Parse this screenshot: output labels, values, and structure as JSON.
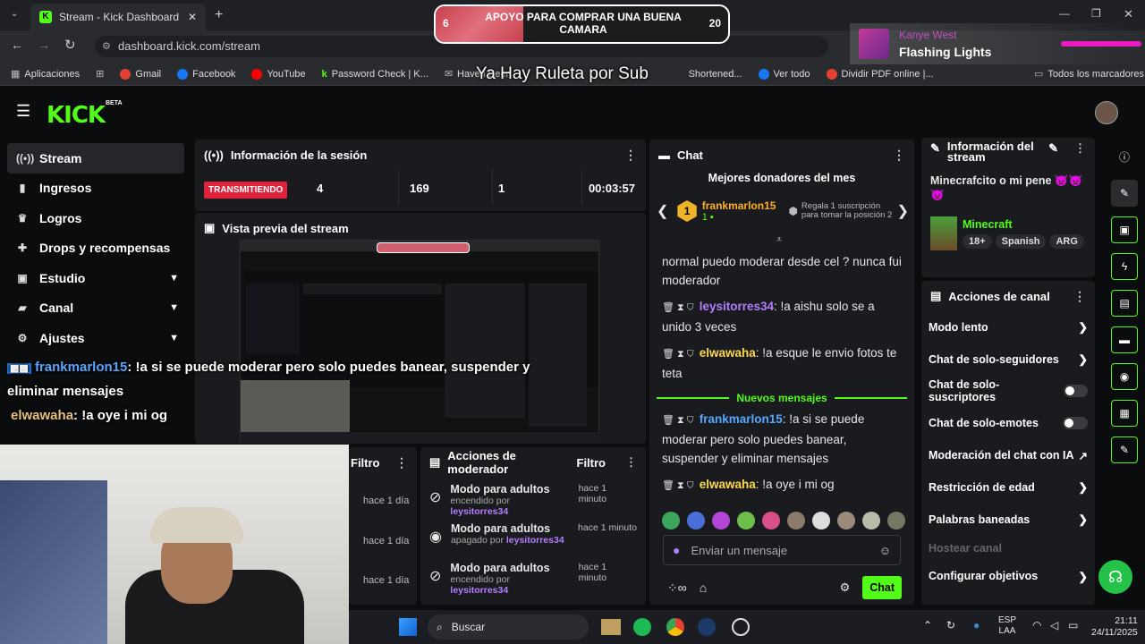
{
  "browser": {
    "tab_title": "Stream - Kick Dashboard",
    "url": "dashboard.kick.com/stream",
    "bookmarks": [
      "Aplicaciones",
      "Gmail",
      "Facebook",
      "YouTube",
      "Password Check | K...",
      "Have I Been",
      "Shortened...",
      "Ver todo",
      "Dividir PDF online |..."
    ],
    "all_bookmarks": "Todos los marcadores"
  },
  "overlay": {
    "goal_label": "APOYO PARA COMPRAR UNA BUENA CAMARA",
    "goal_current": "6",
    "goal_target": "20",
    "goal_progress": 0.3,
    "ruleta_text": "Ya Hay Ruleta por Sub",
    "now_playing_artist": "Kanye West",
    "now_playing_song": "Flashing Lights",
    "chat_overlay": [
      {
        "user": "frankmarlon15",
        "text": ": !a si se puede moderar pero solo puedes banear, suspender y eliminar mensajes"
      },
      {
        "user": "elwawaha",
        "text": ": !a oye i mi og"
      }
    ]
  },
  "kick": {
    "logo": "KICK",
    "logo_badge": "BETA"
  },
  "sidebar": {
    "items": [
      {
        "label": "Stream",
        "icon": "broadcast-icon"
      },
      {
        "label": "Ingresos",
        "icon": "chart-icon"
      },
      {
        "label": "Logros",
        "icon": "trophy-icon"
      },
      {
        "label": "Drops y recompensas",
        "icon": "gift-icon"
      },
      {
        "label": "Estudio",
        "icon": "studio-icon"
      },
      {
        "label": "Canal",
        "icon": "channel-icon"
      },
      {
        "label": "Ajustes",
        "icon": "gear-icon"
      }
    ]
  },
  "session": {
    "title": "Información de la sesión",
    "status": "TRANSMITIENDO",
    "viewers": "4",
    "followers": "169",
    "subs": "1",
    "uptime": "00:03:57"
  },
  "preview": {
    "title": "Vista previa del stream"
  },
  "mod_actions": {
    "title": "Acciones de moderador",
    "filter": "Filtro",
    "left_filter": "Filtro",
    "left_times": [
      "hace 1 día",
      "hace 1 día",
      "hace 1 día"
    ],
    "items": [
      {
        "title": "Modo para adultos",
        "time": "hace 1 minuto",
        "prefix": "encendido por",
        "user": "leysitorres34",
        "icon": "eye-off-icon"
      },
      {
        "title": "Modo para adultos",
        "time": "hace 1 minuto",
        "prefix": "apagado por",
        "user": "leysitorres34",
        "icon": "eye-icon"
      },
      {
        "title": "Modo para adultos",
        "time": "hace 1 minuto",
        "prefix": "encendido por",
        "user": "leysitorres34",
        "icon": "eye-off-icon"
      }
    ]
  },
  "chat": {
    "title": "Chat",
    "top_donors_title": "Mejores donadores del mes",
    "top_donor_rank": "1",
    "top_donor_name": "frankmarlon15",
    "top_donor_count": "1",
    "gift_hint": "Regala 1 suscripción para tomar la posición 2",
    "messages": [
      {
        "user": "",
        "text": "normal puedo moderar desde cel ? nunca fui moderador"
      },
      {
        "user": "leysitorres34",
        "text": ": !a aishu solo se a unido 3 veces"
      },
      {
        "user": "elwawaha",
        "text": ": !a esque le envio fotos te teta"
      }
    ],
    "new_divider": "Nuevos mensajes",
    "new_messages": [
      {
        "user": "frankmarlon15",
        "text": ": !a si se puede moderar pero solo puedes banear, suspender y eliminar mensajes"
      },
      {
        "user": "elwawaha",
        "text": ": !a oye i mi og"
      }
    ],
    "input_placeholder": "Enviar un mensaje",
    "send_label": "Chat"
  },
  "stream_info": {
    "title": "Información del stream",
    "stream_title": "Minecrafcito o mi pene 👿👿👿",
    "category": "Minecraft",
    "tags": [
      "18+",
      "Spanish",
      "ARG"
    ]
  },
  "channel_actions": {
    "title": "Acciones de canal",
    "items": [
      {
        "label": "Modo lento",
        "control": "arrow"
      },
      {
        "label": "Chat de solo-seguidores",
        "control": "arrow"
      },
      {
        "label": "Chat de solo-suscriptores",
        "control": "toggle"
      },
      {
        "label": "Chat de solo-emotes",
        "control": "toggle"
      },
      {
        "label": "Moderación del chat con IA",
        "control": "external"
      },
      {
        "label": "Restricción de edad",
        "control": "arrow"
      },
      {
        "label": "Palabras baneadas",
        "control": "arrow"
      },
      {
        "label": "Hostear canal",
        "control": "none"
      },
      {
        "label": "Configurar objetivos",
        "control": "arrow"
      }
    ]
  },
  "taskbar": {
    "search": "Buscar",
    "lang": "ESP",
    "lang2": "LAA",
    "time": "21:11",
    "date": "24/11/2025"
  },
  "colors": {
    "accent": "#53fc18",
    "live": "#e0223a",
    "user_green": "#8fd16a",
    "user_blue": "#58a6ff",
    "user_purple": "#b47dff",
    "user_yellow": "#ffd84d"
  }
}
